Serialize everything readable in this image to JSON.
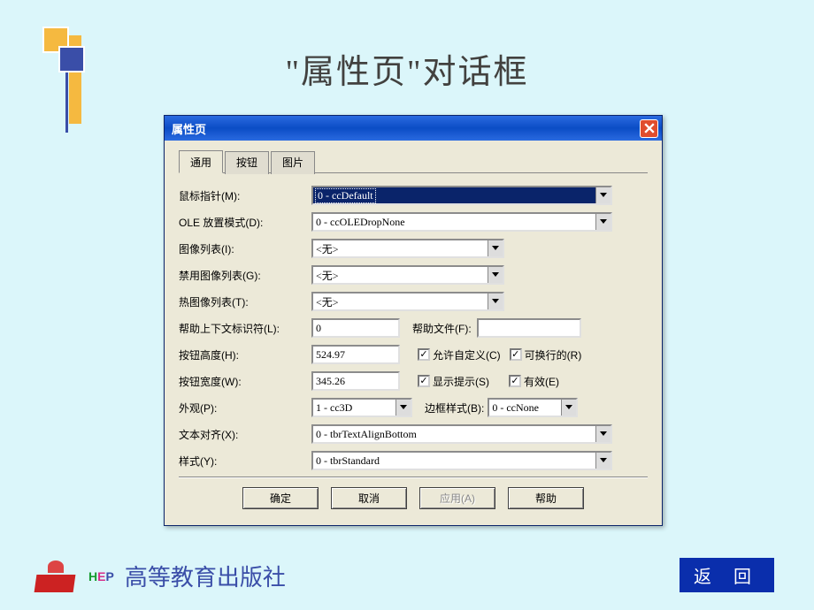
{
  "slide": {
    "title": "\"属性页\"对话框"
  },
  "footer": {
    "publisher": "高等教育出版社",
    "hep": "HEP",
    "return": "返 回"
  },
  "dialog": {
    "title": "属性页",
    "tabs": {
      "general": "通用",
      "button": "按钮",
      "picture": "图片"
    },
    "labels": {
      "mouse": "鼠标指针(M):",
      "ole": "OLE 放置模式(D):",
      "imglist": "图像列表(I):",
      "disimglist": "禁用图像列表(G):",
      "hotimglist": "热图像列表(T):",
      "helpctx": "帮助上下文标识符(L):",
      "helpfile": "帮助文件(F):",
      "btnh": "按钮高度(H):",
      "btnw": "按钮宽度(W):",
      "appear": "外观(P):",
      "border": "边框样式(B):",
      "align": "文本对齐(X):",
      "style": "样式(Y):",
      "allowcustom": "允许自定义(C)",
      "wrap": "可换行的(R)",
      "showtip": "显示提示(S)",
      "enabled": "有效(E)"
    },
    "values": {
      "mouse": "0 - ccDefault",
      "ole": "0 - ccOLEDropNone",
      "imglist": "<无>",
      "disimglist": "<无>",
      "hotimglist": "<无>",
      "helpctx": "0",
      "helpfile": "",
      "btnh": "524.97",
      "btnw": "345.26",
      "appear": "1 - cc3D",
      "border": "0 - ccNone",
      "align": "0 - tbrTextAlignBottom",
      "style": "0 - tbrStandard"
    },
    "checks": {
      "allowcustom": true,
      "wrap": true,
      "showtip": true,
      "enabled": true
    },
    "buttons": {
      "ok": "确定",
      "cancel": "取消",
      "apply": "应用(A)",
      "help": "帮助"
    }
  }
}
